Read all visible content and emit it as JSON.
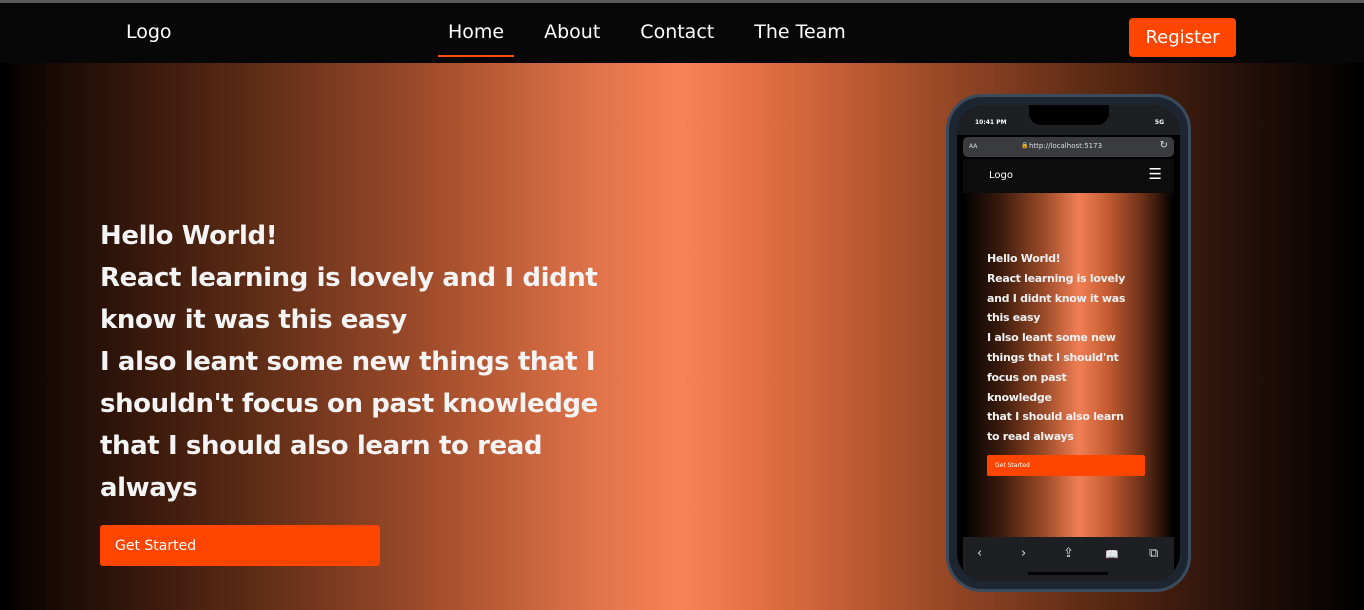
{
  "navbar": {
    "logo": "Logo",
    "links": [
      "Home",
      "About",
      "Contact",
      "The Team"
    ],
    "active": "Home",
    "register_label": "Register"
  },
  "hero": {
    "lines": [
      "Hello World!",
      "React learning is lovely and I didnt\nknow it was this easy",
      "I also leant some new things that I\nshouldn't focus on past knowledge",
      "that I should also learn to read\nalways"
    ],
    "button_label": "Get Started"
  },
  "phone": {
    "status_time": "10:41 PM",
    "status_signal": "5G",
    "url_aa": "AA",
    "url": "http://localhost:5173",
    "logo": "Logo",
    "menu_icon": "☰",
    "lines": [
      "Hello World!",
      "React learning is lovely\nand I didnt know it was\nthis easy",
      "I also leant some new\nthings that I should'nt\nfocus on past\nknowledge",
      "that I should also learn\nto read always"
    ],
    "button_label": "Get Started",
    "toolbar": [
      "‹",
      "›",
      "⇪",
      "📖",
      "⧉"
    ]
  },
  "colors": {
    "accent": "#ff4500"
  }
}
